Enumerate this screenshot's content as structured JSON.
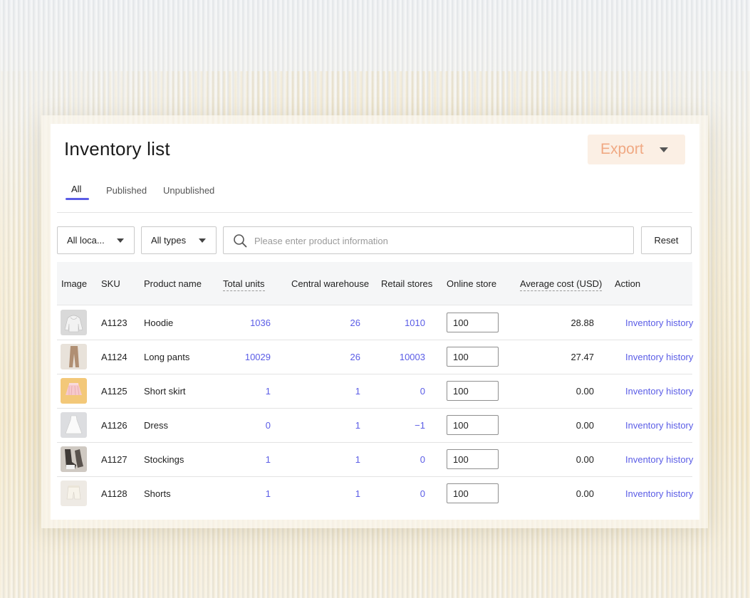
{
  "header": {
    "title": "Inventory list",
    "export_label": "Export"
  },
  "tabs": [
    {
      "label": "All",
      "active": true
    },
    {
      "label": "Published",
      "active": false
    },
    {
      "label": "Unpublished",
      "active": false
    }
  ],
  "filters": {
    "location": "All loca...",
    "type": "All types",
    "search_placeholder": "Please enter product information",
    "reset_label": "Reset"
  },
  "table": {
    "columns": [
      "Image",
      "SKU",
      "Product name",
      "Total units",
      "Central warehouse",
      "Retail stores",
      "Online store",
      "Average cost (USD)",
      "Action"
    ],
    "rows": [
      {
        "image": "hoodie-image",
        "sku": "A1123",
        "name": "Hoodie",
        "total": "1036",
        "central": "26",
        "retail": "1010",
        "online": "100",
        "cost": "28.88",
        "action": "Inventory history"
      },
      {
        "image": "long-pants-image",
        "sku": "A1124",
        "name": "Long pants",
        "total": "10029",
        "central": "26",
        "retail": "10003",
        "online": "100",
        "cost": "27.47",
        "action": "Inventory history"
      },
      {
        "image": "short-skirt-image",
        "sku": "A1125",
        "name": "Short skirt",
        "total": "1",
        "central": "1",
        "retail": "0",
        "online": "100",
        "cost": "0.00",
        "action": "Inventory history"
      },
      {
        "image": "dress-image",
        "sku": "A1126",
        "name": "Dress",
        "total": "0",
        "central": "1",
        "retail": "−1",
        "online": "100",
        "cost": "0.00",
        "action": "Inventory history"
      },
      {
        "image": "stockings-image",
        "sku": "A1127",
        "name": "Stockings",
        "total": "1",
        "central": "1",
        "retail": "0",
        "online": "100",
        "cost": "0.00",
        "action": "Inventory history"
      },
      {
        "image": "shorts-image",
        "sku": "A1128",
        "name": "Shorts",
        "total": "1",
        "central": "1",
        "retail": "0",
        "online": "100",
        "cost": "0.00",
        "action": "Inventory history"
      }
    ]
  },
  "colors": {
    "accent": "#5a5ce6",
    "export_bg": "#fbefe4",
    "export_text": "#f0a983"
  }
}
